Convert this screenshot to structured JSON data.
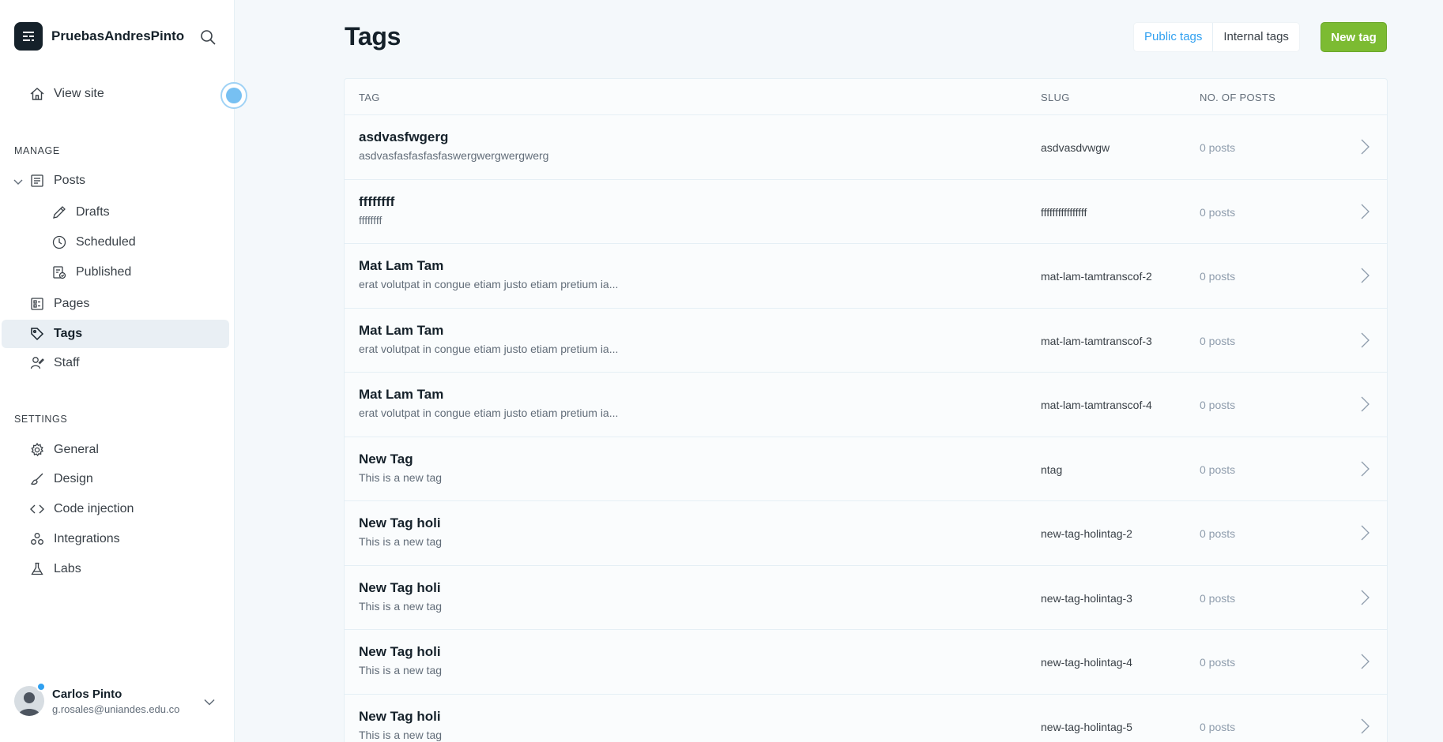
{
  "sidebar": {
    "brand": {
      "name": "PruebasAndresPinto"
    },
    "view_site": "View site",
    "manage_title": "MANAGE",
    "settings_title": "SETTINGS",
    "items": {
      "posts": "Posts",
      "drafts": "Drafts",
      "scheduled": "Scheduled",
      "published": "Published",
      "pages": "Pages",
      "tags": "Tags",
      "staff": "Staff",
      "general": "General",
      "design": "Design",
      "code_injection": "Code injection",
      "integrations": "Integrations",
      "labs": "Labs"
    },
    "user": {
      "name": "Carlos Pinto",
      "email": "g.rosales@uniandes.edu.co"
    }
  },
  "header": {
    "title": "Tags",
    "tabs": {
      "public": "Public tags",
      "internal": "Internal tags"
    },
    "new_button": "New tag"
  },
  "table": {
    "columns": {
      "tag": "TAG",
      "slug": "SLUG",
      "posts": "NO. OF POSTS"
    },
    "rows": [
      {
        "name": "asdvasfwgerg",
        "description": "asdvasfasfasfasfaswergwergwergwerg",
        "slug": "asdvasdvwgw",
        "posts": "0 posts"
      },
      {
        "name": "ffffffff",
        "description": "ffffffff",
        "slug": "ffffffffffffffff",
        "posts": "0 posts"
      },
      {
        "name": "Mat Lam Tam",
        "description": "erat volutpat in congue etiam justo etiam pretium ia...",
        "slug": "mat-lam-tamtranscof-2",
        "posts": "0 posts"
      },
      {
        "name": "Mat Lam Tam",
        "description": "erat volutpat in congue etiam justo etiam pretium ia...",
        "slug": "mat-lam-tamtranscof-3",
        "posts": "0 posts"
      },
      {
        "name": "Mat Lam Tam",
        "description": "erat volutpat in congue etiam justo etiam pretium ia...",
        "slug": "mat-lam-tamtranscof-4",
        "posts": "0 posts"
      },
      {
        "name": "New Tag",
        "description": "This is a new tag",
        "slug": "ntag",
        "posts": "0 posts"
      },
      {
        "name": "New Tag holi",
        "description": "This is a new tag",
        "slug": "new-tag-holintag-2",
        "posts": "0 posts"
      },
      {
        "name": "New Tag holi",
        "description": "This is a new tag",
        "slug": "new-tag-holintag-3",
        "posts": "0 posts"
      },
      {
        "name": "New Tag holi",
        "description": "This is a new tag",
        "slug": "new-tag-holintag-4",
        "posts": "0 posts"
      },
      {
        "name": "New Tag holi",
        "description": "This is a new tag",
        "slug": "new-tag-holintag-5",
        "posts": "0 posts"
      }
    ]
  },
  "colors": {
    "accent_green": "#7cbb32",
    "accent_blue": "#30a0f0",
    "sidebar_active": "#e9eff4"
  }
}
